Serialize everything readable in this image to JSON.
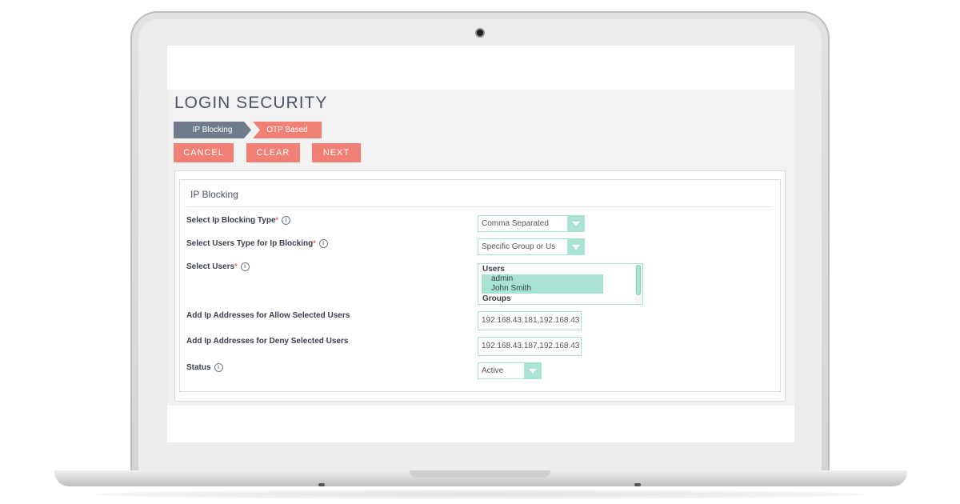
{
  "page": {
    "title": "LOGIN SECURITY"
  },
  "steps": [
    {
      "label": "IP Blocking"
    },
    {
      "label": "OTP Based"
    }
  ],
  "buttons": {
    "cancel": "CANCEL",
    "clear": "CLEAR",
    "next": "NEXT"
  },
  "panel": {
    "title": "IP Blocking",
    "fields": {
      "blocking_type": {
        "label": "Select Ip Blocking Type",
        "required": "*",
        "value": "Comma Separated"
      },
      "users_type": {
        "label": "Select Users Type for Ip Blocking",
        "required": "*",
        "value": "Specific Group or Us"
      },
      "select_users": {
        "label": "Select Users",
        "required": "*",
        "group_users": "Users",
        "options": [
          "admin",
          "John Smith"
        ],
        "group_groups": "Groups"
      },
      "allow_ips": {
        "label": "Add Ip Addresses for Allow Selected Users",
        "value": "192.168.43.181,192.168.43"
      },
      "deny_ips": {
        "label": "Add Ip Addresses for Deny Selected Users",
        "value": "192.168.43.187,192.168.43"
      },
      "status": {
        "label": "Status",
        "value": "Active"
      }
    }
  },
  "icons": {
    "info": "i"
  },
  "colors": {
    "accent": "#f07f76",
    "step_active": "#6f7b88",
    "field_border": "#a8e3d4",
    "heading": "#4d5466"
  }
}
